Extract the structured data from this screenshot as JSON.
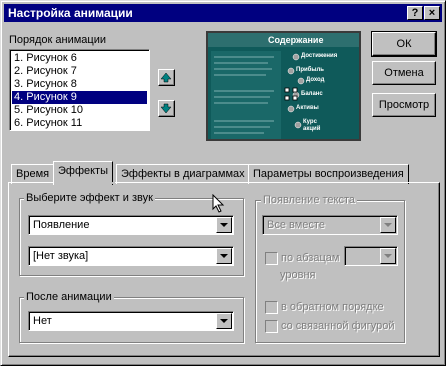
{
  "window": {
    "title": "Настройка анимации",
    "help_label": "?",
    "close_label": "×"
  },
  "order_label": "Порядок анимации",
  "order_list": [
    "1. Рисунок 6",
    "2. Рисунок 7",
    "3. Рисунок 8",
    "4. Рисунок 9",
    "5. Рисунок 10",
    "6. Рисунок 11"
  ],
  "selected_index": 3,
  "buttons": {
    "ok": "ОК",
    "cancel": "Отмена",
    "preview": "Просмотр"
  },
  "preview": {
    "heading": "Содержание",
    "items": [
      "Достижения",
      "Прибыль",
      "Доход",
      "Баланс",
      "Активы",
      "Курс акций"
    ]
  },
  "tabs": [
    "Время",
    "Эффекты",
    "Эффекты в диаграммах",
    "Параметры воспроизведения"
  ],
  "active_tab": 1,
  "effects": {
    "group_label": "Выберите эффект и звук",
    "effect_value": "Появление",
    "sound_value": "[Нет звука]"
  },
  "after": {
    "group_label": "После анимации",
    "value": "Нет"
  },
  "text": {
    "group_label": "Появление текста",
    "mode_value": "Все вместе",
    "by_paragraph_label": "по абзацам",
    "levels_label": "уровня",
    "reverse_label": "в обратном порядке",
    "attached_label": "со связанной фигурой"
  },
  "colors": {
    "titlebar": "#000080",
    "preview_bg": "#0f5a5a",
    "selection": "#000080"
  }
}
